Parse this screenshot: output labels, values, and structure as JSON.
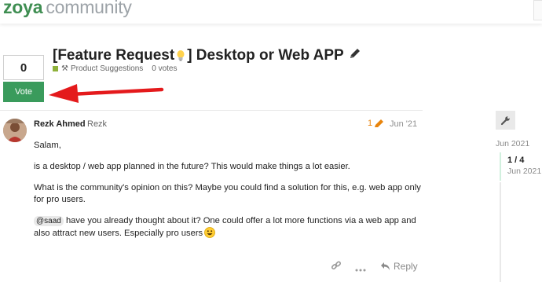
{
  "header": {
    "brand": "zoya",
    "community": "community"
  },
  "vote": {
    "count": "0",
    "button_label": "Vote"
  },
  "topic": {
    "title_part1": "[Feature Request ",
    "title_part2": "] Desktop or Web APP",
    "category": "Product Suggestions",
    "vote_info": "0 votes"
  },
  "post": {
    "author_name": "Rezk Ahmed",
    "author_username": "Rezk",
    "edit_count": "1",
    "date": "Jun '21",
    "greeting": "Salam,",
    "paragraph1": "is a desktop / web app planned in the future? This would make things a lot easier.",
    "paragraph2": "What is the community's opinion on this? Maybe you could find a solution for this, e.g. web app only for pro users.",
    "mention": "@saad",
    "paragraph3": " have you already thought about it? One could offer a lot more functions via a web app and also attract new users. Especially pro users",
    "reply_label": "Reply"
  },
  "timeline": {
    "start_date": "Jun 2021",
    "position": "1 / 4",
    "position_date": "Jun 2021"
  },
  "colors": {
    "brand_green": "#3f8e52",
    "vote_button": "#3a9b5c",
    "category": "#8fb23b",
    "arrow": "#e41a1c",
    "edit_orange": "#e8840c"
  },
  "icons": [
    "lightbulb-icon",
    "pencil-icon",
    "tools-icon",
    "edit-pencil-icon",
    "link-icon",
    "more-icon",
    "reply-icon",
    "wrench-icon",
    "smile-emoji-icon"
  ]
}
